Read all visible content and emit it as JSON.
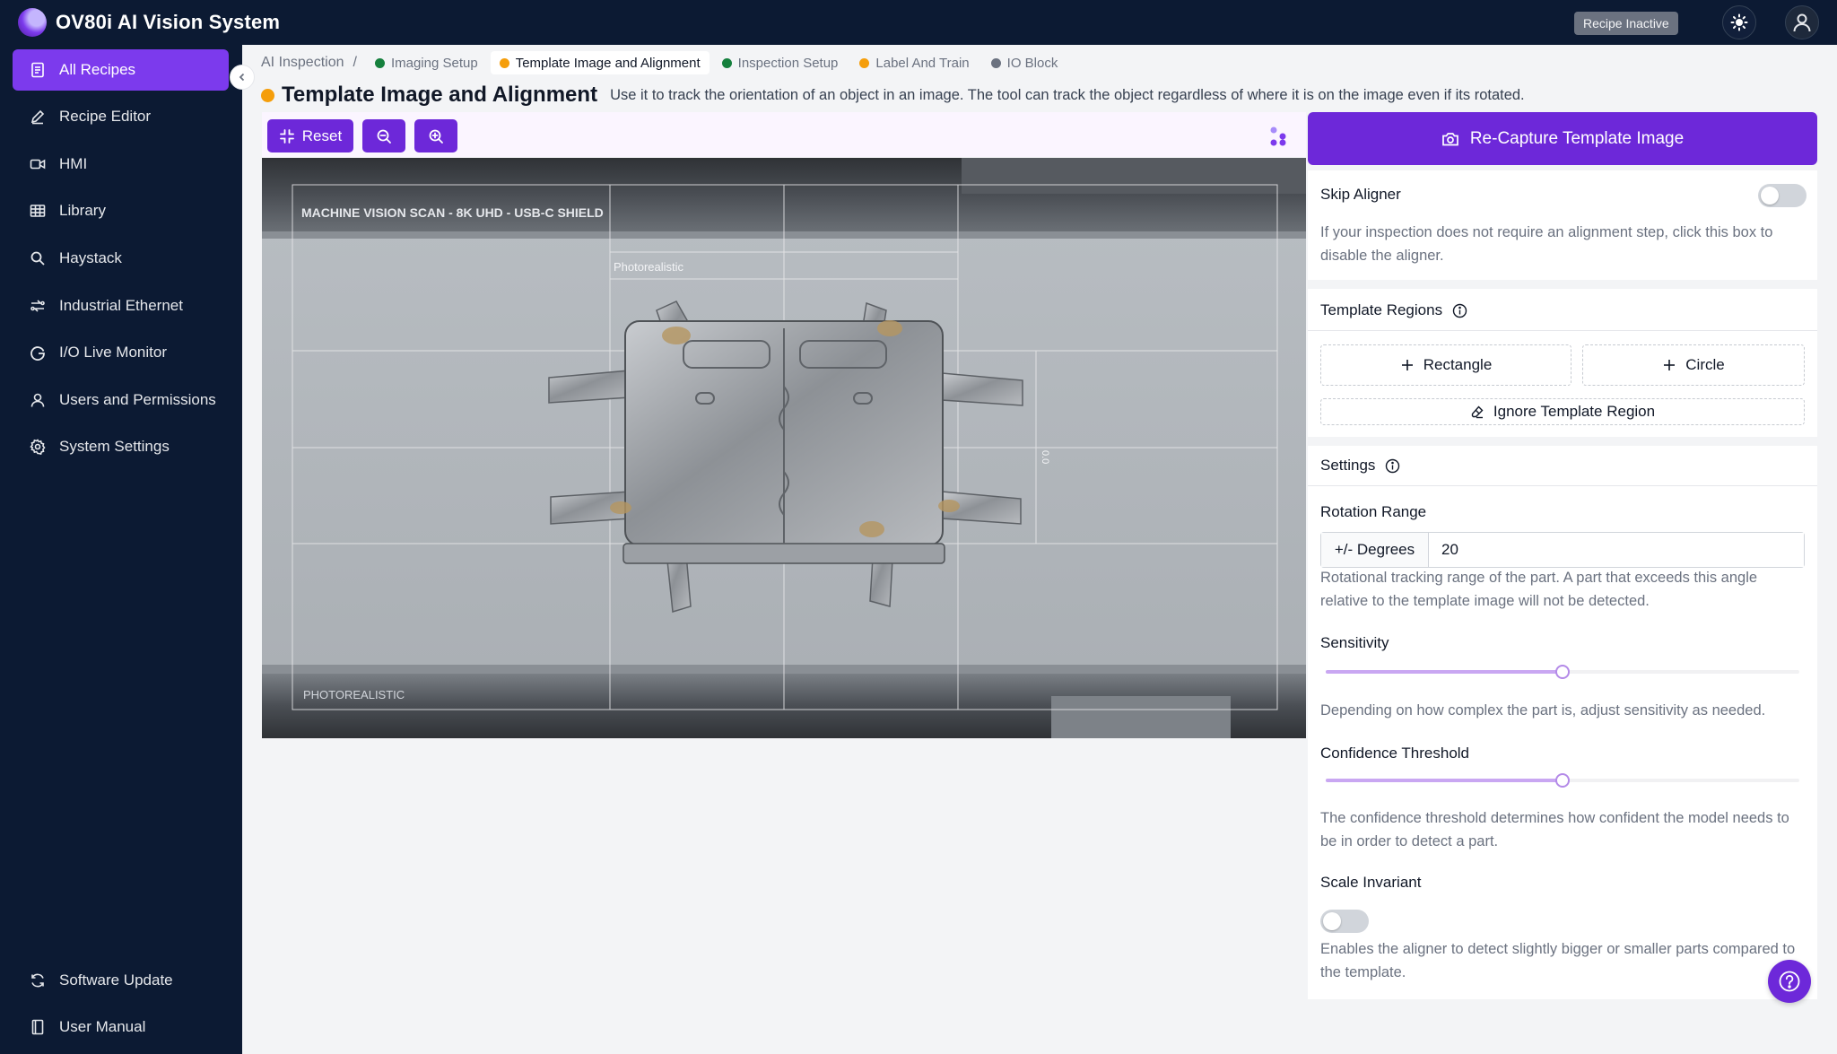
{
  "app": {
    "title": "OV80i AI Vision System",
    "recipe_status": "Recipe Inactive"
  },
  "sidebar": {
    "items": [
      {
        "label": "All Recipes",
        "icon": "recipes-icon",
        "active": true
      },
      {
        "label": "Recipe Editor",
        "icon": "pencil-icon"
      },
      {
        "label": "HMI",
        "icon": "video-icon"
      },
      {
        "label": "Library",
        "icon": "table-icon"
      },
      {
        "label": "Haystack",
        "icon": "search-icon"
      },
      {
        "label": "Industrial Ethernet",
        "icon": "network-icon"
      },
      {
        "label": "I/O Live Monitor",
        "icon": "monitor-icon"
      },
      {
        "label": "Users and Permissions",
        "icon": "user-icon"
      },
      {
        "label": "System Settings",
        "icon": "gear-icon"
      }
    ],
    "footer": [
      {
        "label": "Software Update",
        "icon": "refresh-icon"
      },
      {
        "label": "User Manual",
        "icon": "book-icon"
      }
    ]
  },
  "breadcrumb": {
    "root": "AI Inspection",
    "separator": "/",
    "steps": [
      {
        "label": "Imaging Setup",
        "status_color": "#15803d"
      },
      {
        "label": "Template Image and Alignment",
        "status_color": "#f59e0b",
        "active": true
      },
      {
        "label": "Inspection Setup",
        "status_color": "#15803d"
      },
      {
        "label": "Label And Train",
        "status_color": "#f59e0b"
      },
      {
        "label": "IO Block",
        "status_color": "#6b7280"
      }
    ]
  },
  "page": {
    "title": "Template Image and Alignment",
    "status_color": "#f59e0b",
    "description": "Use it to track the orientation of an object in an image. The tool can track the object regardless of where it is on the image even if its rotated."
  },
  "toolbar": {
    "reset_label": "Reset"
  },
  "image": {
    "top_caption": "MACHINE VISION SCAN - 8K UHD - USB-C SHIELD",
    "inner_caption": "Photorealistic",
    "bottom_caption": "PHOTOREALISTIC",
    "side_label": "0.0"
  },
  "panel": {
    "recapture_label": "Re-Capture Template Image",
    "skip_aligner": {
      "label": "Skip Aligner",
      "enabled": false,
      "help": "If your inspection does not require an alignment step, click this box to disable the aligner."
    },
    "template_regions": {
      "title": "Template Regions",
      "rectangle_label": "Rectangle",
      "circle_label": "Circle",
      "ignore_label": "Ignore Template Region"
    },
    "settings": {
      "title": "Settings",
      "rotation_range": {
        "label": "Rotation Range",
        "addon": "+/- Degrees",
        "value": "20",
        "help": "Rotational tracking range of the part. A part that exceeds this angle relative to the template image will not be detected."
      },
      "sensitivity": {
        "label": "Sensitivity",
        "value": 0.5,
        "help": "Depending on how complex the part is, adjust sensitivity as needed."
      },
      "confidence_threshold": {
        "label": "Confidence Threshold",
        "value": 0.5,
        "help": "The confidence threshold determines how confident the model needs to be in order to detect a part."
      },
      "scale_invariant": {
        "label": "Scale Invariant",
        "enabled": false,
        "help": "Enables the aligner to detect slightly bigger or smaller parts compared to the template."
      }
    }
  },
  "colors": {
    "accent": "#6d28d9",
    "sidebar_bg": "#0c1a33",
    "active_nav": "#7c3aed"
  }
}
